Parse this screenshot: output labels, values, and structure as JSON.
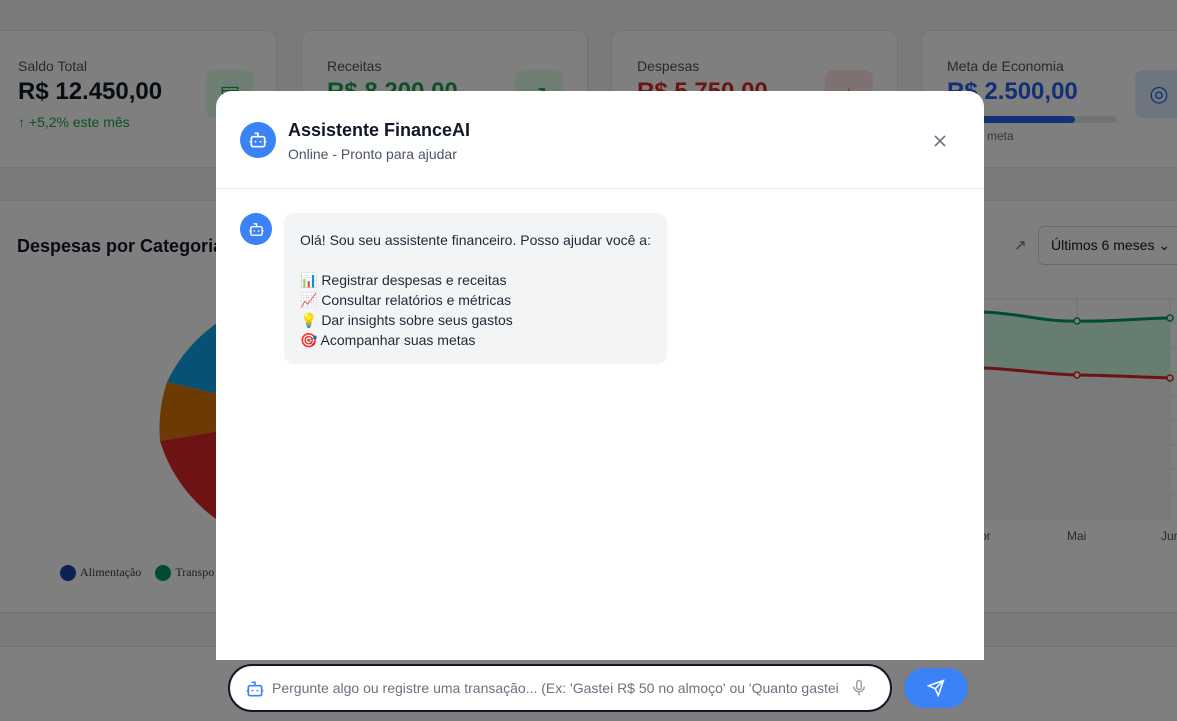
{
  "dashboard": {
    "cards": [
      {
        "label": "Saldo Total",
        "value": "R$ 12.450,00",
        "sub": "+5,2% este mês",
        "value_color": "#111827",
        "icon": "wallet-icon"
      },
      {
        "label": "Receitas",
        "value": "R$ 8.200,00",
        "value_color": "#16a34a",
        "icon": "trend-up-icon"
      },
      {
        "label": "Despesas",
        "value": "R$ 5.750,00",
        "value_color": "#dc2626",
        "icon": "arrow-down-icon"
      },
      {
        "label": "Meta de Economia",
        "value": "R$ 2.500,00",
        "sub": "a meta",
        "value_color": "#2563eb",
        "icon": "target-icon",
        "progress": 0.75
      }
    ],
    "expenses_panel": {
      "title": "Despesas por Categoria",
      "legend": [
        "Alimentação",
        "Transpo"
      ]
    },
    "trend_panel": {
      "period_select": "Últimos 6 meses",
      "x_labels": [
        "Abr",
        "Mai",
        "Jun"
      ]
    }
  },
  "modal": {
    "title": "Assistente FinanceAI",
    "status": "Online - Pronto para ajudar",
    "message": {
      "intro": "Olá! Sou seu assistente financeiro. Posso ajudar você a:",
      "items": [
        "📊 Registrar despesas e receitas",
        "📈 Consultar relatórios e métricas",
        "💡 Dar insights sobre seus gastos",
        "🎯 Acompanhar suas metas"
      ]
    }
  },
  "chat": {
    "placeholder": "Pergunte algo ou registre uma transação... (Ex: 'Gastei R$ 50 no almoço' ou 'Quanto gastei"
  },
  "colors": {
    "accent": "#3b82f6",
    "income": "#16a34a",
    "expense": "#dc2626",
    "goal": "#2563eb"
  }
}
